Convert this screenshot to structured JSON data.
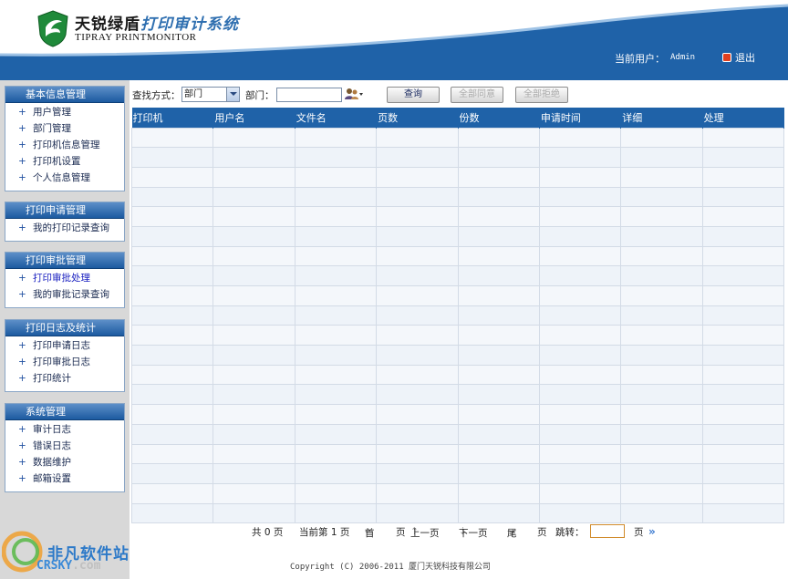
{
  "header": {
    "brand_cn_a": "天锐绿盾",
    "brand_cn_b": "打印审计系统",
    "brand_en": "TIPRAY PRINTMONITOR",
    "user_label": "当前用户：",
    "user_name": "Admin",
    "logout_label": "退出",
    "colors": {
      "band": "#1f62a8",
      "accent": "#2f6fb0"
    }
  },
  "sidebar": {
    "groups": [
      {
        "title": "基本信息管理",
        "items": [
          "用户管理",
          "部门管理",
          "打印机信息管理",
          "打印机设置",
          "个人信息管理"
        ]
      },
      {
        "title": "打印申请管理",
        "items": [
          "我的打印记录查询"
        ]
      },
      {
        "title": "打印审批管理",
        "items": [
          "打印审批处理",
          "我的审批记录查询"
        ]
      },
      {
        "title": "打印日志及统计",
        "items": [
          "打印申请日志",
          "打印审批日志",
          "打印统计"
        ]
      },
      {
        "title": "系统管理",
        "items": [
          "审计日志",
          "错误日志",
          "数据维护",
          "邮箱设置"
        ]
      }
    ],
    "item_prefix": "+"
  },
  "toolbar": {
    "search_method_label": "查找方式：",
    "search_method_value": "部门",
    "dept_label": "部门：",
    "query_btn": "查询",
    "approve_all_btn": "全部同意",
    "reject_all_btn": "全部拒绝"
  },
  "table": {
    "columns": [
      "打印机",
      "用户名",
      "文件名",
      "页数",
      "份数",
      "申请时间",
      "详细",
      "处理"
    ]
  },
  "pager": {
    "total": "共 0 页",
    "current": "当前第 1 页",
    "first": "首",
    "page1": "页",
    "prev": "上一页",
    "next": "下一页",
    "last": "尾",
    "page2": "页",
    "jump_label": "跳转：",
    "page3": "页"
  },
  "footer": {
    "copyright": "Copyright (C) 2006-2011 厦门天锐科技有限公司"
  },
  "watermark": {
    "cn": "非凡软件站",
    "en": "CRSKY",
    "dom": ".com"
  }
}
